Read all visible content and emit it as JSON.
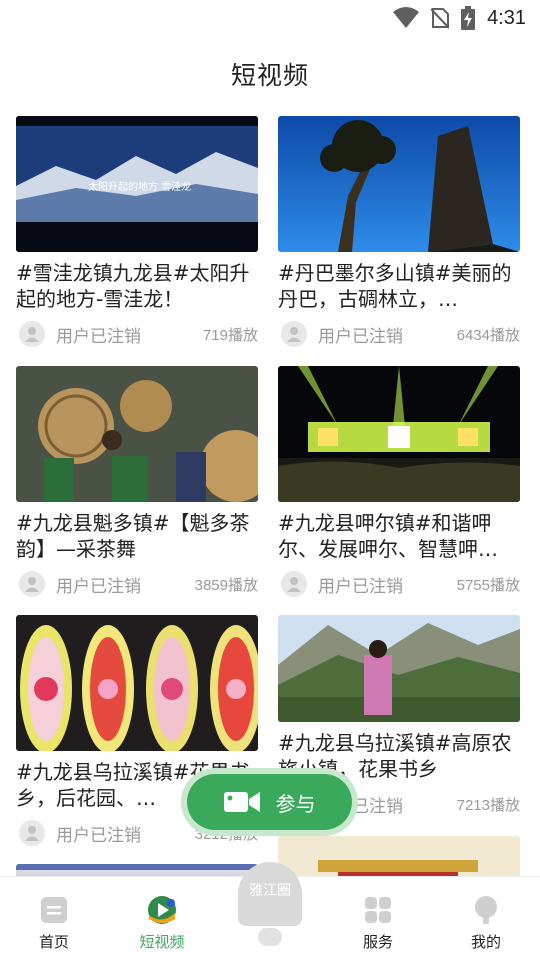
{
  "status_bar": {
    "time": "4:31"
  },
  "header": {
    "title": "短视频"
  },
  "videos": [
    {
      "title": "#雪洼龙镇九龙县#太阳升起的地方-雪洼龙！",
      "author": "用户已注销",
      "plays": "719播放",
      "overlay_text": "太阳升起的地方 雪洼龙"
    },
    {
      "title": "#丹巴墨尔多山镇#美丽的丹巴，古碉林立，…",
      "author": "用户已注销",
      "plays": "6434播放"
    },
    {
      "title": "#九龙县魁多镇#【魁多茶韵】—采茶舞",
      "author": "用户已注销",
      "plays": "3859播放"
    },
    {
      "title": "#九龙县呷尔镇#和谐呷尔、发展呷尔、智慧呷…",
      "author": "用户已注销",
      "plays": "5755播放"
    },
    {
      "title": "#九龙县乌拉溪镇#花果书乡，后花园、…",
      "author": "用户已注销",
      "plays": "3212播放"
    },
    {
      "title": "#九龙县乌拉溪镇#高原农旅小镇，花果书乡",
      "author": "用户已注销",
      "plays": "7213播放"
    }
  ],
  "participate_button": {
    "label": "参与",
    "icon": "video-camera-icon"
  },
  "bottom_nav": {
    "items": [
      {
        "label": "首页",
        "icon": "home-icon",
        "active": false
      },
      {
        "label": "短视频",
        "icon": "short-video-icon",
        "active": true
      },
      {
        "label": "雅江圈",
        "icon": "circle-icon",
        "active": false
      },
      {
        "label": "服务",
        "icon": "grid-icon",
        "active": false
      },
      {
        "label": "我的",
        "icon": "profile-icon",
        "active": false
      }
    ]
  },
  "colors": {
    "accent": "#3aa95c",
    "muted": "#9a9a9a",
    "text": "#222222"
  }
}
